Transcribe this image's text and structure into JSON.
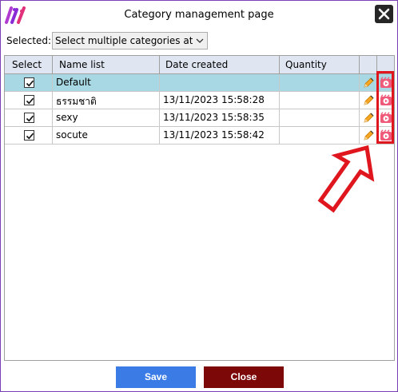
{
  "window": {
    "title": "Category management page"
  },
  "toolbar": {
    "selected_label": "Selected:",
    "selected_value": "Select multiple categories at the s"
  },
  "grid": {
    "columns": [
      "Select",
      "Name list",
      "Date created",
      "Quantity"
    ],
    "rows": [
      {
        "checked": true,
        "name": "Default",
        "date": "",
        "quantity": ""
      },
      {
        "checked": true,
        "name": "ธรรมชาติ",
        "date": "13/11/2023 15:58:28",
        "quantity": ""
      },
      {
        "checked": true,
        "name": "sexy",
        "date": "13/11/2023 15:58:35",
        "quantity": ""
      },
      {
        "checked": true,
        "name": "socute",
        "date": "13/11/2023 15:58:42",
        "quantity": ""
      }
    ]
  },
  "footer": {
    "save_label": "Save",
    "close_label": "Close"
  },
  "icons": {
    "row_edit": "pencil-icon",
    "row_view": "play-video-icon",
    "app": "app-logo-icon",
    "close": "close-icon"
  },
  "colors": {
    "accent": "#3a7be6",
    "close_button": "#7c0808",
    "selected_row": "#a8d8e4",
    "header": "#dfe6f2",
    "highlight": "#e0161e"
  }
}
